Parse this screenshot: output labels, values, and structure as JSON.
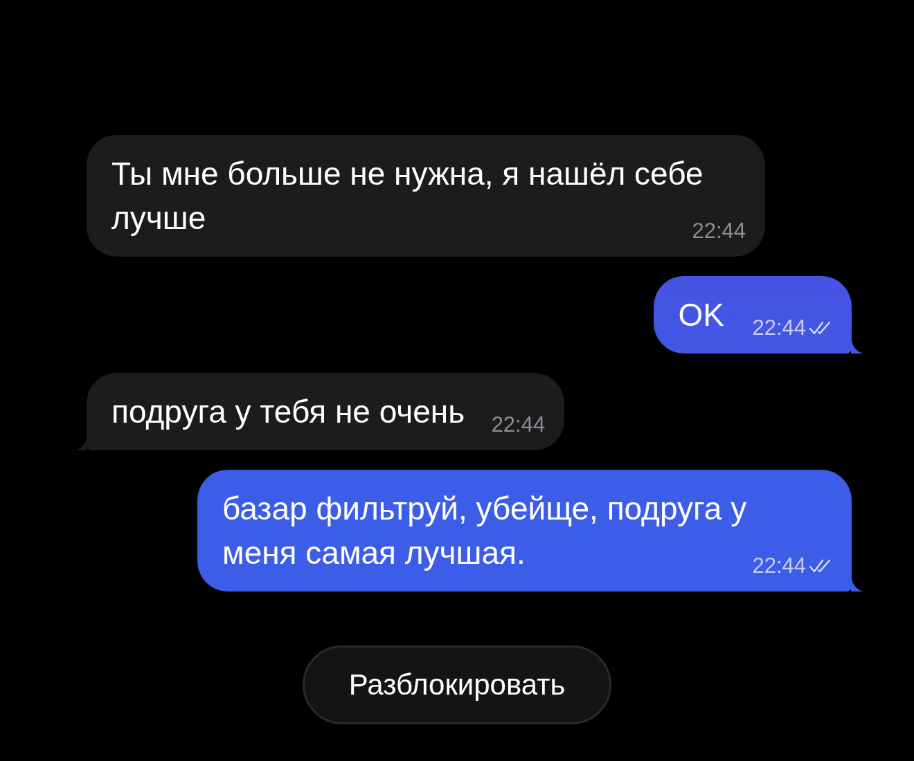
{
  "messages": [
    {
      "kind": "incoming",
      "text": "Ты мне больше не нужна, я нашёл себе лучше",
      "time": "22:44",
      "tail": false
    },
    {
      "kind": "outgoing",
      "text": "OK",
      "time": "22:44",
      "read": true,
      "tail": true
    },
    {
      "kind": "incoming",
      "text": "подруга у тебя не очень",
      "time": "22:44",
      "tail": true
    },
    {
      "kind": "outgoing",
      "text": "базар фильтруй, убейще, подруга у меня самая лучшая.",
      "time": "22:44",
      "read": true,
      "tail": true
    }
  ],
  "unblock_button": {
    "label": "Разблокировать"
  }
}
